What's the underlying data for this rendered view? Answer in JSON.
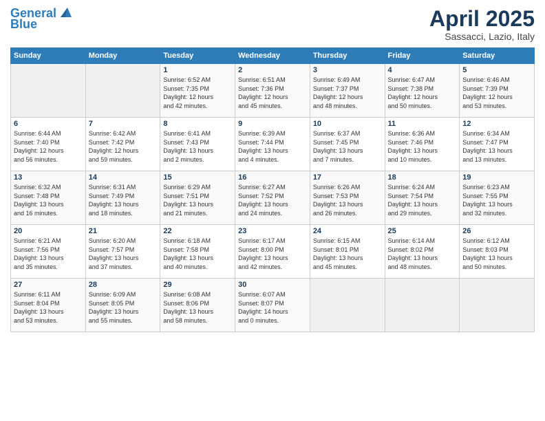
{
  "logo": {
    "line1": "General",
    "line2": "Blue"
  },
  "title": "April 2025",
  "subtitle": "Sassacci, Lazio, Italy",
  "days_header": [
    "Sunday",
    "Monday",
    "Tuesday",
    "Wednesday",
    "Thursday",
    "Friday",
    "Saturday"
  ],
  "weeks": [
    [
      {
        "day": "",
        "text": ""
      },
      {
        "day": "",
        "text": ""
      },
      {
        "day": "1",
        "text": "Sunrise: 6:52 AM\nSunset: 7:35 PM\nDaylight: 12 hours\nand 42 minutes."
      },
      {
        "day": "2",
        "text": "Sunrise: 6:51 AM\nSunset: 7:36 PM\nDaylight: 12 hours\nand 45 minutes."
      },
      {
        "day": "3",
        "text": "Sunrise: 6:49 AM\nSunset: 7:37 PM\nDaylight: 12 hours\nand 48 minutes."
      },
      {
        "day": "4",
        "text": "Sunrise: 6:47 AM\nSunset: 7:38 PM\nDaylight: 12 hours\nand 50 minutes."
      },
      {
        "day": "5",
        "text": "Sunrise: 6:46 AM\nSunset: 7:39 PM\nDaylight: 12 hours\nand 53 minutes."
      }
    ],
    [
      {
        "day": "6",
        "text": "Sunrise: 6:44 AM\nSunset: 7:40 PM\nDaylight: 12 hours\nand 56 minutes."
      },
      {
        "day": "7",
        "text": "Sunrise: 6:42 AM\nSunset: 7:42 PM\nDaylight: 12 hours\nand 59 minutes."
      },
      {
        "day": "8",
        "text": "Sunrise: 6:41 AM\nSunset: 7:43 PM\nDaylight: 13 hours\nand 2 minutes."
      },
      {
        "day": "9",
        "text": "Sunrise: 6:39 AM\nSunset: 7:44 PM\nDaylight: 13 hours\nand 4 minutes."
      },
      {
        "day": "10",
        "text": "Sunrise: 6:37 AM\nSunset: 7:45 PM\nDaylight: 13 hours\nand 7 minutes."
      },
      {
        "day": "11",
        "text": "Sunrise: 6:36 AM\nSunset: 7:46 PM\nDaylight: 13 hours\nand 10 minutes."
      },
      {
        "day": "12",
        "text": "Sunrise: 6:34 AM\nSunset: 7:47 PM\nDaylight: 13 hours\nand 13 minutes."
      }
    ],
    [
      {
        "day": "13",
        "text": "Sunrise: 6:32 AM\nSunset: 7:48 PM\nDaylight: 13 hours\nand 16 minutes."
      },
      {
        "day": "14",
        "text": "Sunrise: 6:31 AM\nSunset: 7:49 PM\nDaylight: 13 hours\nand 18 minutes."
      },
      {
        "day": "15",
        "text": "Sunrise: 6:29 AM\nSunset: 7:51 PM\nDaylight: 13 hours\nand 21 minutes."
      },
      {
        "day": "16",
        "text": "Sunrise: 6:27 AM\nSunset: 7:52 PM\nDaylight: 13 hours\nand 24 minutes."
      },
      {
        "day": "17",
        "text": "Sunrise: 6:26 AM\nSunset: 7:53 PM\nDaylight: 13 hours\nand 26 minutes."
      },
      {
        "day": "18",
        "text": "Sunrise: 6:24 AM\nSunset: 7:54 PM\nDaylight: 13 hours\nand 29 minutes."
      },
      {
        "day": "19",
        "text": "Sunrise: 6:23 AM\nSunset: 7:55 PM\nDaylight: 13 hours\nand 32 minutes."
      }
    ],
    [
      {
        "day": "20",
        "text": "Sunrise: 6:21 AM\nSunset: 7:56 PM\nDaylight: 13 hours\nand 35 minutes."
      },
      {
        "day": "21",
        "text": "Sunrise: 6:20 AM\nSunset: 7:57 PM\nDaylight: 13 hours\nand 37 minutes."
      },
      {
        "day": "22",
        "text": "Sunrise: 6:18 AM\nSunset: 7:58 PM\nDaylight: 13 hours\nand 40 minutes."
      },
      {
        "day": "23",
        "text": "Sunrise: 6:17 AM\nSunset: 8:00 PM\nDaylight: 13 hours\nand 42 minutes."
      },
      {
        "day": "24",
        "text": "Sunrise: 6:15 AM\nSunset: 8:01 PM\nDaylight: 13 hours\nand 45 minutes."
      },
      {
        "day": "25",
        "text": "Sunrise: 6:14 AM\nSunset: 8:02 PM\nDaylight: 13 hours\nand 48 minutes."
      },
      {
        "day": "26",
        "text": "Sunrise: 6:12 AM\nSunset: 8:03 PM\nDaylight: 13 hours\nand 50 minutes."
      }
    ],
    [
      {
        "day": "27",
        "text": "Sunrise: 6:11 AM\nSunset: 8:04 PM\nDaylight: 13 hours\nand 53 minutes."
      },
      {
        "day": "28",
        "text": "Sunrise: 6:09 AM\nSunset: 8:05 PM\nDaylight: 13 hours\nand 55 minutes."
      },
      {
        "day": "29",
        "text": "Sunrise: 6:08 AM\nSunset: 8:06 PM\nDaylight: 13 hours\nand 58 minutes."
      },
      {
        "day": "30",
        "text": "Sunrise: 6:07 AM\nSunset: 8:07 PM\nDaylight: 14 hours\nand 0 minutes."
      },
      {
        "day": "",
        "text": ""
      },
      {
        "day": "",
        "text": ""
      },
      {
        "day": "",
        "text": ""
      }
    ]
  ]
}
